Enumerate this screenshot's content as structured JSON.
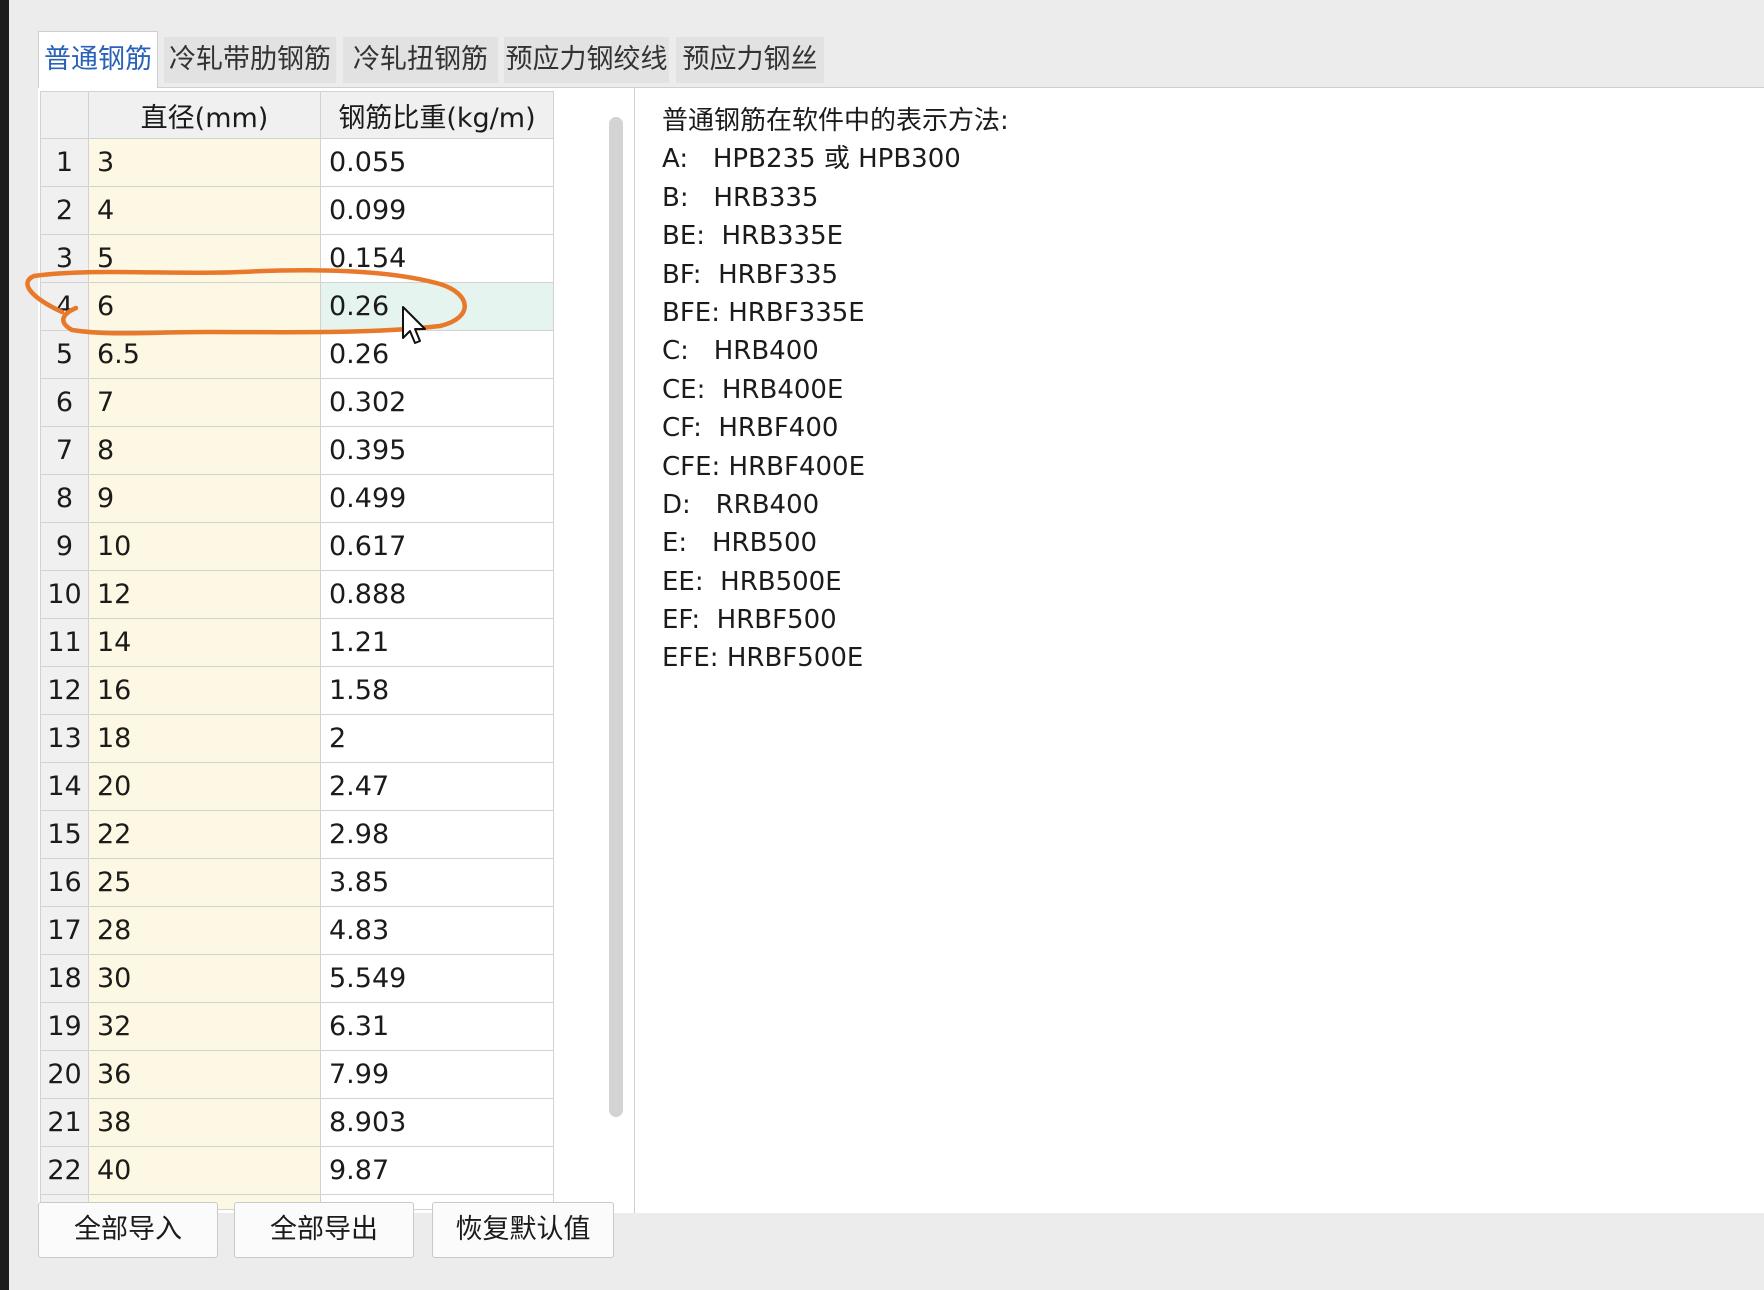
{
  "tabs": [
    "普通钢筋",
    "冷轧带肋钢筋",
    "冷轧扭钢筋",
    "预应力钢绞线",
    "预应力钢丝"
  ],
  "active_tab": 0,
  "table": {
    "headers": [
      "直径(mm)",
      "钢筋比重(kg/m)"
    ],
    "selected_row": 4,
    "rows": [
      {
        "no": "1",
        "diameter": "3",
        "weight": "0.055"
      },
      {
        "no": "2",
        "diameter": "4",
        "weight": "0.099"
      },
      {
        "no": "3",
        "diameter": "5",
        "weight": "0.154"
      },
      {
        "no": "4",
        "diameter": "6",
        "weight": "0.26"
      },
      {
        "no": "5",
        "diameter": "6.5",
        "weight": "0.26"
      },
      {
        "no": "6",
        "diameter": "7",
        "weight": "0.302"
      },
      {
        "no": "7",
        "diameter": "8",
        "weight": "0.395"
      },
      {
        "no": "8",
        "diameter": "9",
        "weight": "0.499"
      },
      {
        "no": "9",
        "diameter": "10",
        "weight": "0.617"
      },
      {
        "no": "10",
        "diameter": "12",
        "weight": "0.888"
      },
      {
        "no": "11",
        "diameter": "14",
        "weight": "1.21"
      },
      {
        "no": "12",
        "diameter": "16",
        "weight": "1.58"
      },
      {
        "no": "13",
        "diameter": "18",
        "weight": "2"
      },
      {
        "no": "14",
        "diameter": "20",
        "weight": "2.47"
      },
      {
        "no": "15",
        "diameter": "22",
        "weight": "2.98"
      },
      {
        "no": "16",
        "diameter": "25",
        "weight": "3.85"
      },
      {
        "no": "17",
        "diameter": "28",
        "weight": "4.83"
      },
      {
        "no": "18",
        "diameter": "30",
        "weight": "5.549"
      },
      {
        "no": "19",
        "diameter": "32",
        "weight": "6.31"
      },
      {
        "no": "20",
        "diameter": "36",
        "weight": "7.99"
      },
      {
        "no": "21",
        "diameter": "38",
        "weight": "8.903"
      },
      {
        "no": "22",
        "diameter": "40",
        "weight": "9.87"
      }
    ]
  },
  "info": {
    "title": "普通钢筋在软件中的表示方法:",
    "lines": [
      "A:   HPB235 或 HPB300",
      "B:   HRB335",
      "BE:  HRB335E",
      "BF:  HRBF335",
      "BFE: HRBF335E",
      "C:   HRB400",
      "CE:  HRB400E",
      "CF:  HRBF400",
      "CFE: HRBF400E",
      "D:   RRB400",
      "E:   HRB500",
      "EE:  HRB500E",
      "EF:  HRBF500",
      "EFE: HRBF500E"
    ]
  },
  "buttons": {
    "import_all": "全部导入",
    "export_all": "全部导出",
    "restore_defaults": "恢复默认值"
  },
  "colors": {
    "accent": "#2a62b8",
    "diameter_bg": "#fdf8e4",
    "selected_bg": "#e6f4ef",
    "annotation": "#e8782a"
  }
}
